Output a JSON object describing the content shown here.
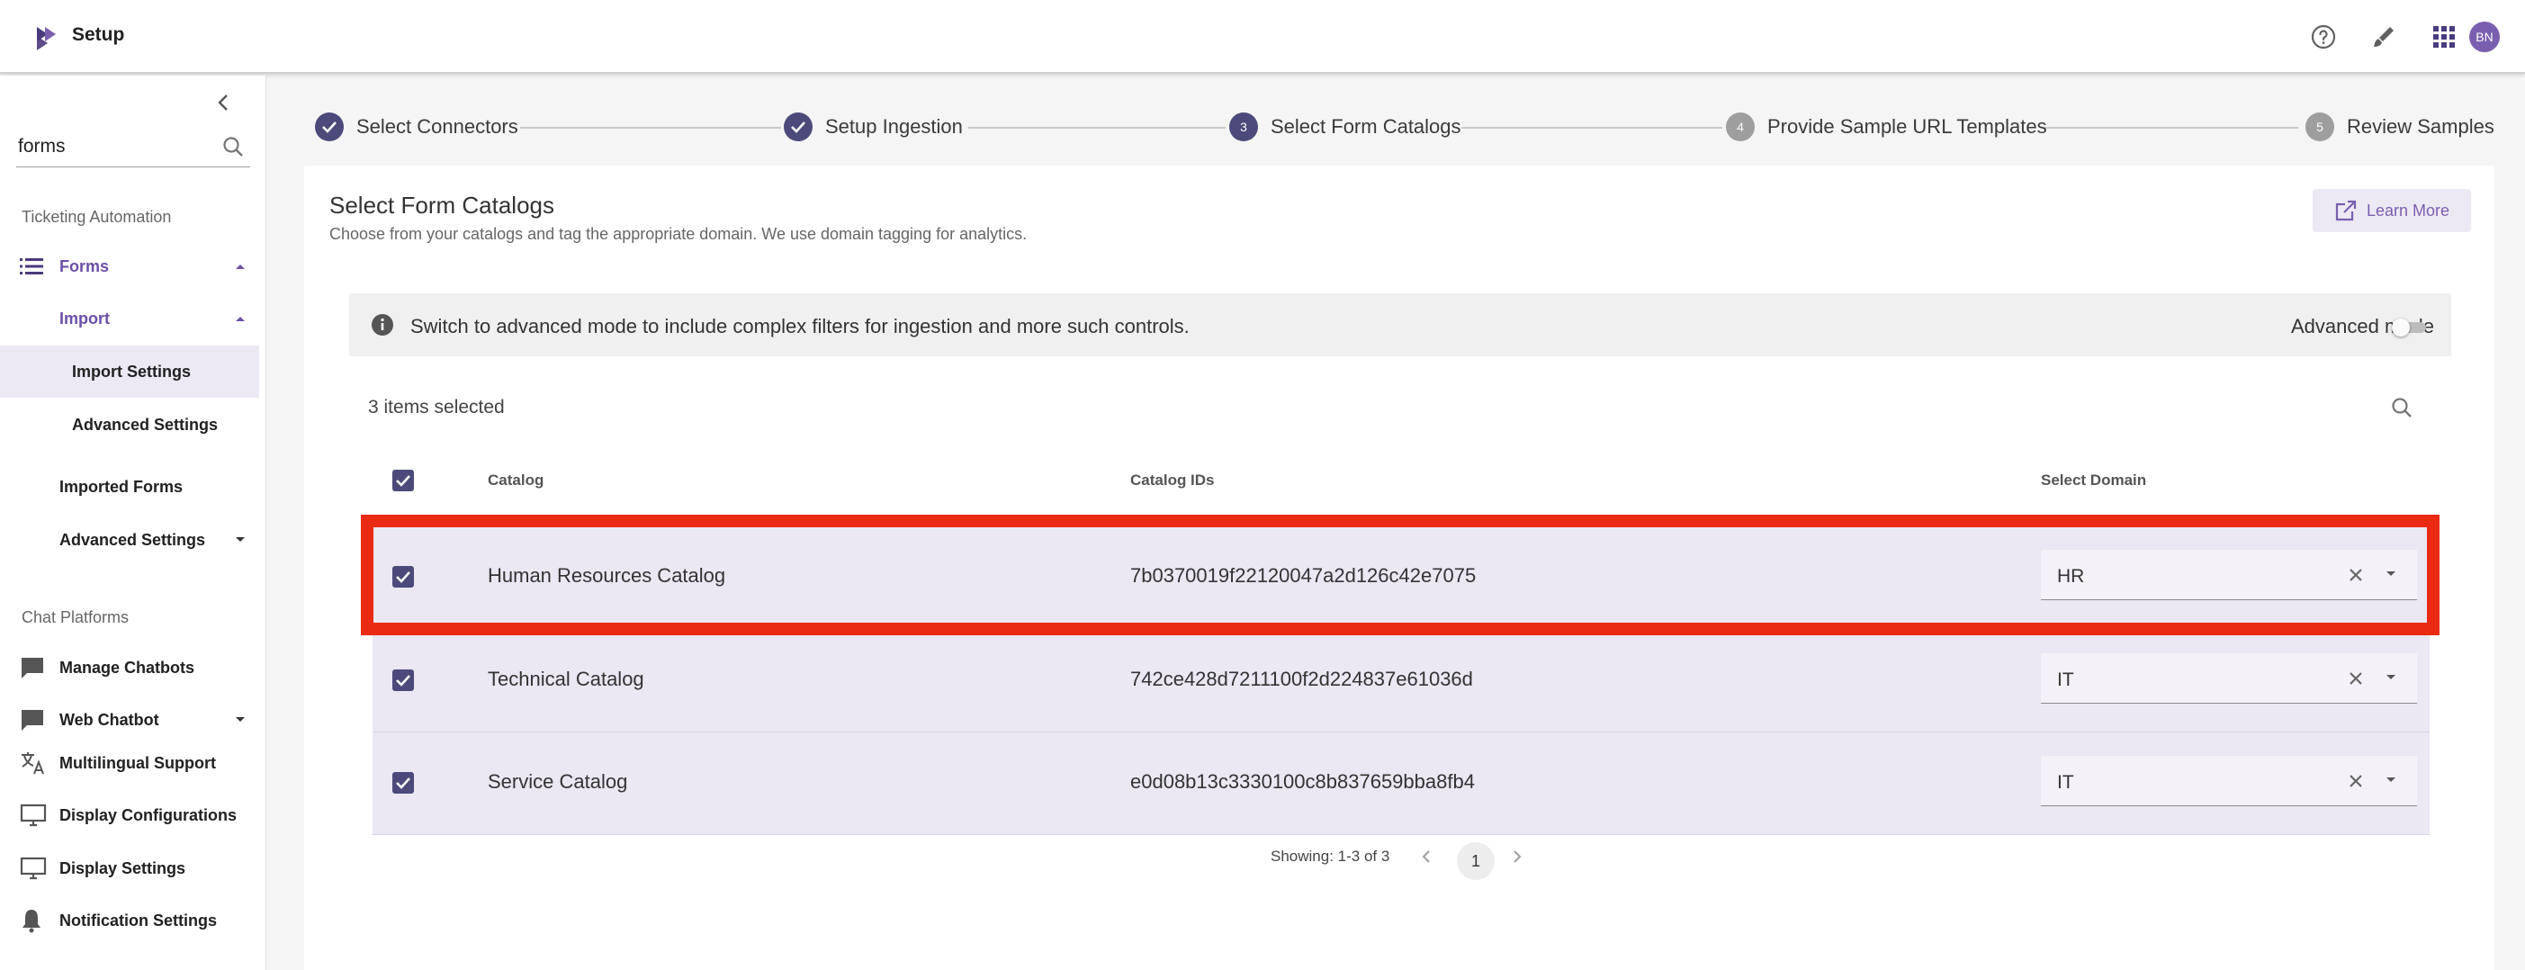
{
  "app": {
    "title": "Setup",
    "avatar_initials": "BN"
  },
  "topbar_icons": [
    "help-icon",
    "brush-icon",
    "apps-grid-icon"
  ],
  "sidebar": {
    "search_value": "forms",
    "sections": [
      {
        "label": "Ticketing Automation"
      },
      {
        "label": "Chat Platforms"
      }
    ],
    "forms": {
      "label": "Forms",
      "import": {
        "label": "Import",
        "children": [
          {
            "label": "Import Settings",
            "selected": true
          },
          {
            "label": "Advanced Settings"
          }
        ]
      },
      "others": [
        {
          "label": "Imported Forms"
        },
        {
          "label": "Advanced Settings"
        }
      ]
    },
    "chat_items": [
      {
        "label": "Manage Chatbots",
        "icon": "chat-bubble-icon"
      },
      {
        "label": "Web Chatbot",
        "icon": "chat-bubble-icon"
      },
      {
        "label": "Multilingual Support",
        "icon": "translate-icon"
      },
      {
        "label": "Display Configurations",
        "icon": "monitor-icon"
      },
      {
        "label": "Display Settings",
        "icon": "monitor-icon"
      },
      {
        "label": "Notification Settings",
        "icon": "bell-icon"
      }
    ]
  },
  "stepper": {
    "steps": [
      {
        "label": "Select Connectors",
        "state": "done"
      },
      {
        "label": "Setup Ingestion",
        "state": "done"
      },
      {
        "label": "Select Form Catalogs",
        "number": "3",
        "state": "active"
      },
      {
        "label": "Provide Sample URL Templates",
        "number": "4",
        "state": "pending"
      },
      {
        "label": "Review Samples",
        "number": "5",
        "state": "pending"
      }
    ]
  },
  "main": {
    "title": "Select Form Catalogs",
    "subtitle": "Choose from your catalogs and tag the appropriate domain. We use domain tagging for analytics.",
    "learn_more": "Learn More",
    "info_text": "Switch to advanced mode to include complex filters for ingestion and more such controls.",
    "advanced_mode_label": "Advanced mode",
    "advanced_mode_on": false,
    "items_selected": "3 items selected"
  },
  "table": {
    "columns": [
      "Catalog",
      "Catalog IDs",
      "Select Domain"
    ],
    "rows": [
      {
        "catalog": "Human Resources Catalog",
        "catalog_id": "7b0370019f22120047a2d126c42e7075",
        "domain": "HR",
        "checked": true
      },
      {
        "catalog": "Technical Catalog",
        "catalog_id": "742ce428d7211100f2d224837e61036d",
        "domain": "IT",
        "checked": true
      },
      {
        "catalog": "Service Catalog",
        "catalog_id": "e0d08b13c3330100c8b837659bba8fb4",
        "domain": "IT",
        "checked": true
      }
    ]
  },
  "pagination": {
    "showing": "Showing: 1-3 of 3",
    "current_page": "1"
  },
  "colors": {
    "accent": "#6b4fa8",
    "checkbox": "#4b4a7a",
    "row_bg": "#ebe7f3",
    "highlight": "#ea2a12"
  }
}
